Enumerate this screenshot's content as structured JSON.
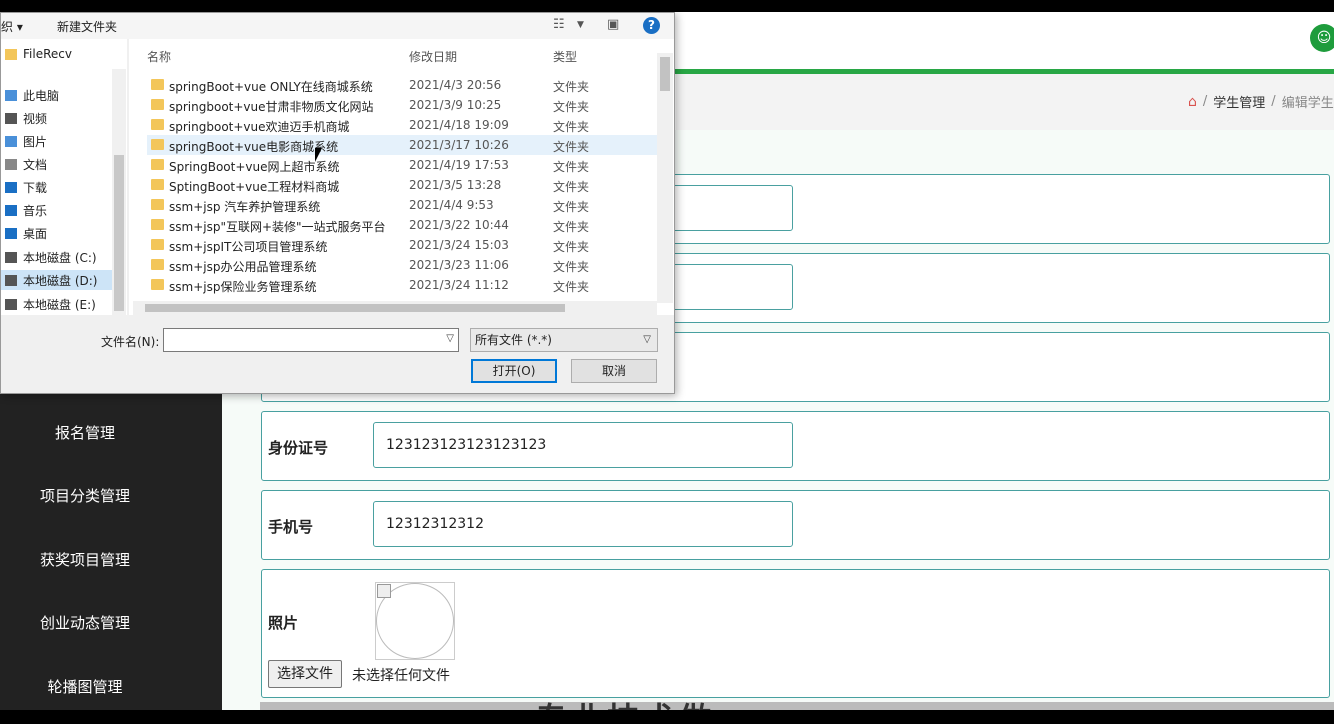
{
  "page": {
    "user_icon": "user-icon",
    "breadcrumb": {
      "home_icon": "home-icon",
      "sep": "/",
      "section": "学生管理",
      "current": "编辑学生"
    },
    "sidebar": [
      "报名管理",
      "项目分类管理",
      "获奖项目管理",
      "创业动态管理",
      "轮播图管理"
    ],
    "form": {
      "id_card": {
        "label": "身份证号",
        "value": "123123123123123123"
      },
      "phone": {
        "label": "手机号",
        "value": "12312312312"
      },
      "photo": {
        "label": "照片",
        "button": "选择文件",
        "status": "未选择任何文件"
      }
    },
    "footer_title": "专业技术做"
  },
  "dialog": {
    "toolbar": {
      "organize": "织 ▾",
      "new_folder": "新建文件夹"
    },
    "nav": [
      {
        "label": "FileRecv",
        "icon": "folder-icon",
        "color": "#f3c65a"
      },
      {
        "label": "此电脑",
        "icon": "computer-icon",
        "color": "#4a90d9"
      },
      {
        "label": "视频",
        "icon": "video-icon",
        "color": "#555555"
      },
      {
        "label": "图片",
        "icon": "picture-icon",
        "color": "#4a90d9"
      },
      {
        "label": "文档",
        "icon": "document-icon",
        "color": "#888888"
      },
      {
        "label": "下载",
        "icon": "download-icon",
        "color": "#1a6fc4"
      },
      {
        "label": "音乐",
        "icon": "music-icon",
        "color": "#1a6fc4"
      },
      {
        "label": "桌面",
        "icon": "desktop-icon",
        "color": "#1a6fc4"
      },
      {
        "label": "本地磁盘 (C:)",
        "icon": "drive-icon",
        "color": "#555555"
      },
      {
        "label": "本地磁盘 (D:)",
        "icon": "drive-icon",
        "color": "#555555"
      },
      {
        "label": "本地磁盘 (E:)",
        "icon": "drive-icon",
        "color": "#555555"
      }
    ],
    "columns": {
      "name": "名称",
      "date": "修改日期",
      "type": "类型"
    },
    "files": [
      {
        "name": "springBoot+vue ONLY在线商城系统",
        "date": "2021/4/3 20:56",
        "type": "文件夹"
      },
      {
        "name": "springboot+vue甘肃非物质文化网站",
        "date": "2021/3/9 10:25",
        "type": "文件夹"
      },
      {
        "name": "springboot+vue欢迪迈手机商城",
        "date": "2021/4/18 19:09",
        "type": "文件夹"
      },
      {
        "name": "springBoot+vue电影商城系统",
        "date": "2021/3/17 10:26",
        "type": "文件夹"
      },
      {
        "name": "SpringBoot+vue网上超市系统",
        "date": "2021/4/19 17:53",
        "type": "文件夹"
      },
      {
        "name": "SptingBoot+vue工程材料商城",
        "date": "2021/3/5 13:28",
        "type": "文件夹"
      },
      {
        "name": "ssm+jsp 汽车养护管理系统",
        "date": "2021/4/4 9:53",
        "type": "文件夹"
      },
      {
        "name": "ssm+jsp\"互联网+装修\"一站式服务平台",
        "date": "2021/3/22 10:44",
        "type": "文件夹"
      },
      {
        "name": "ssm+jspIT公司项目管理系统",
        "date": "2021/3/24 15:03",
        "type": "文件夹"
      },
      {
        "name": "ssm+jsp办公用品管理系统",
        "date": "2021/3/23 11:06",
        "type": "文件夹"
      },
      {
        "name": "ssm+jsp保险业务管理系统",
        "date": "2021/3/24 11:12",
        "type": "文件夹"
      }
    ],
    "filename_label": "文件名(N):",
    "filename_value": "",
    "filter": "所有文件 (*.*)",
    "open": "打开(O)",
    "cancel": "取消"
  }
}
